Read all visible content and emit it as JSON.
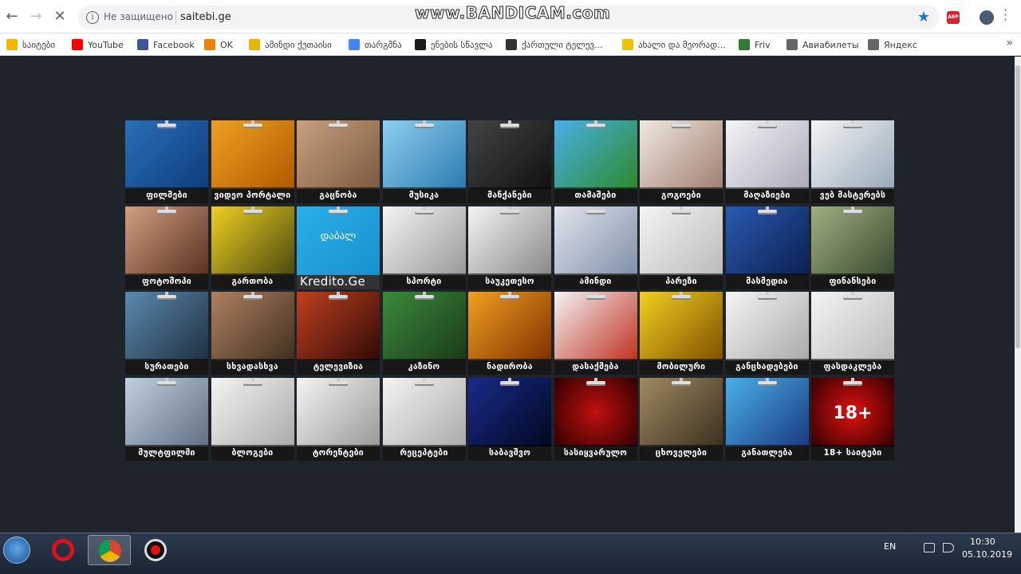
{
  "watermark": "www.BANDICAM.com",
  "address_bar": {
    "security_text": "Не защищено",
    "url": "saitebi.ge"
  },
  "extensions": {
    "adblock_label": "ABP"
  },
  "bookmarks": [
    {
      "label": "საიტები",
      "icon": "bar-chart-icon",
      "color": "#f4b400"
    },
    {
      "label": "YouTube",
      "icon": "youtube-icon",
      "color": "#ff0000"
    },
    {
      "label": "Facebook",
      "icon": "facebook-icon",
      "color": "#3b5998"
    },
    {
      "label": "OK",
      "icon": "odnoklassniki-icon",
      "color": "#ee8208"
    },
    {
      "label": "ამინდი ქუთაისი",
      "icon": "weather-icon",
      "color": "#e8b400"
    },
    {
      "label": "თარგმნა",
      "icon": "translate-icon",
      "color": "#4285f4"
    },
    {
      "label": "ენების სწავლა",
      "icon": "lh-icon",
      "color": "#1a1a1a"
    },
    {
      "label": "ქართული ტელევ...",
      "icon": "drop-icon",
      "color": "#333333"
    },
    {
      "label": "ახალი და მეორად...",
      "icon": "my-icon",
      "color": "#f2c200"
    },
    {
      "label": "Friv",
      "icon": "friv-icon",
      "color": "#2e7d32"
    },
    {
      "label": "Авиабилеты",
      "icon": "globe-icon",
      "color": "#666666"
    },
    {
      "label": "Яндекс",
      "icon": "globe-icon",
      "color": "#666666"
    }
  ],
  "tiles": [
    {
      "label": "ფილმები",
      "icon": "warner-bros-icon",
      "bg": "linear-gradient(135deg,#2a6fb8,#0d3d7a)"
    },
    {
      "label": "ვიდეო პორტალი",
      "icon": "video-camera-icon",
      "bg": "linear-gradient(135deg,#f0a020,#b05a00)"
    },
    {
      "label": "გაცნობა",
      "icon": "couple-icon",
      "bg": "linear-gradient(135deg,#c9a080,#7a5a40)"
    },
    {
      "label": "მუსიკა",
      "icon": "music-note-icon",
      "bg": "linear-gradient(135deg,#8ed0f0,#2a7ab0)"
    },
    {
      "label": "მანქანები",
      "icon": "car-icon",
      "bg": "linear-gradient(135deg,#444,#111)"
    },
    {
      "label": "თამაშები",
      "icon": "mario-icon",
      "bg": "linear-gradient(135deg,#4ab0e8,#2c8a2c)"
    },
    {
      "label": "გოგოები",
      "icon": "girls-icon",
      "bg": "linear-gradient(135deg,#f0e8e0,#a08070)"
    },
    {
      "label": "მაღაზიები",
      "icon": "shopping-cart-icon",
      "bg": "linear-gradient(135deg,#f4f4f4,#aab)"
    },
    {
      "label": "ვებ მასტერებს",
      "icon": "dot-com-icon",
      "bg": "linear-gradient(135deg,#f4f4f4,#9ab)"
    },
    {
      "label": "ფოტოშოპი",
      "icon": "face-icon",
      "bg": "linear-gradient(135deg,#d0a080,#5a3020)"
    },
    {
      "label": "გართობა",
      "icon": "smiley-icon",
      "bg": "linear-gradient(135deg,#f0d020,#4a4a10)"
    },
    {
      "label": "Kredito.Ge",
      "sub": "დაბალ",
      "icon": "credit-icon",
      "bg": "linear-gradient(135deg,#2ab0e8,#1890d0)"
    },
    {
      "label": "სპორტი",
      "icon": "soccer-ball-icon",
      "bg": "linear-gradient(135deg,#f4f4f4,#999)"
    },
    {
      "label": "საუკეთესო",
      "icon": "bar-graph-icon",
      "bg": "linear-gradient(135deg,#f4f4f4,#888)"
    },
    {
      "label": "ამინდი",
      "icon": "weather-icon",
      "bg": "linear-gradient(135deg,#e0e4ec,#8090a8)"
    },
    {
      "label": "პარეზი",
      "icon": "app-icons-icon",
      "bg": "linear-gradient(135deg,#f4f4f4,#bbb)"
    },
    {
      "label": "მასმედია",
      "icon": "news-icon",
      "bg": "linear-gradient(135deg,#2a5ab0,#0a2050)"
    },
    {
      "label": "ფინანსები",
      "icon": "money-man-icon",
      "bg": "linear-gradient(135deg,#a0b080,#3a4a30)"
    },
    {
      "label": "სურათები",
      "icon": "photo-camera-icon",
      "bg": "linear-gradient(135deg,#5a8ab0,#203040)"
    },
    {
      "label": "სხვადასხვა",
      "icon": "collage-icon",
      "bg": "linear-gradient(135deg,#b08060,#403020)"
    },
    {
      "label": "ტელევიზია",
      "icon": "tv-icon",
      "bg": "linear-gradient(135deg,#c04020,#300a05)"
    },
    {
      "label": "კაზინო",
      "icon": "casino-icon",
      "bg": "linear-gradient(135deg,#3a8a3a,#1a3a1a)"
    },
    {
      "label": "ნადირობა",
      "icon": "hunter-icon",
      "bg": "linear-gradient(135deg,#f0a020,#803000)"
    },
    {
      "label": "დასაქმება",
      "icon": "business-icon",
      "bg": "linear-gradient(135deg,#f4f4f4,#c03020)"
    },
    {
      "label": "მობილური",
      "icon": "mobile-phone-icon",
      "bg": "linear-gradient(135deg,#f0d020,#805000)"
    },
    {
      "label": "განცხადებები",
      "icon": "newspaper-man-icon",
      "bg": "linear-gradient(135deg,#f4f4f4,#aaa)"
    },
    {
      "label": "ფასდაკლება",
      "icon": "sale-icon",
      "bg": "linear-gradient(135deg,#f4f4f4,#bbb)"
    },
    {
      "label": "მულტფილმი",
      "icon": "tom-jerry-icon",
      "bg": "linear-gradient(135deg,#c0d0e0,#607080)"
    },
    {
      "label": "ბლოგები",
      "icon": "blog-icon",
      "bg": "linear-gradient(135deg,#f4f4f4,#aaa)"
    },
    {
      "label": "ტორენტები",
      "icon": "utorrent-icon",
      "bg": "linear-gradient(135deg,#f4f4f4,#999)"
    },
    {
      "label": "რეცეპტები",
      "icon": "chef-icon",
      "bg": "linear-gradient(135deg,#f4f4f4,#aaa)"
    },
    {
      "label": "საბავშვო",
      "icon": "baby-laptop-icon",
      "bg": "linear-gradient(135deg,#1a2a8a,#000820)"
    },
    {
      "label": "სასიყვარულო",
      "icon": "heart-icon",
      "bg": "radial-gradient(circle,#c01010,#300000)"
    },
    {
      "label": "ცხოველები",
      "icon": "zebra-icon",
      "bg": "linear-gradient(135deg,#a08a60,#3a3020)"
    },
    {
      "label": "განათლება",
      "icon": "graduation-cap-icon",
      "bg": "linear-gradient(135deg,#4ab0e8,#1a3a80)"
    },
    {
      "label": "18+ საიტები",
      "sub": "18+",
      "icon": "adult-18-icon",
      "bg": "radial-gradient(circle,#e01010,#300000)"
    }
  ],
  "taskbar": {
    "apps": [
      {
        "name": "opera-icon",
        "color": "#e0101a"
      },
      {
        "name": "chrome-icon",
        "color": "#2a9a3a"
      },
      {
        "name": "bandicam-icon",
        "color": "#202020"
      }
    ],
    "language": "EN",
    "time": "10:30",
    "date": "05.10.2019"
  }
}
